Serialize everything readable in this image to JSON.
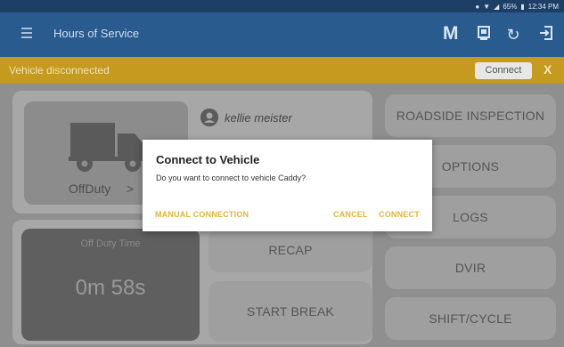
{
  "status_bar": {
    "battery": "65%",
    "time": "12:34 PM"
  },
  "app_bar": {
    "title": "Hours of Service",
    "m_label": "M",
    "icons": [
      "menu-icon",
      "clipboard-icon",
      "refresh-icon",
      "logout-icon"
    ]
  },
  "banner": {
    "text": "Vehicle disconnected",
    "connect_label": "Connect",
    "close_label": "X",
    "color": "#c49a1f"
  },
  "status_card": {
    "duty_status": "OffDuty",
    "chevron": ">"
  },
  "user": {
    "name": "kellie meister"
  },
  "timer": {
    "label": "Off Duty Time",
    "value": "0m 58s"
  },
  "buttons": {
    "recap": "RECAP",
    "start_break": "START BREAK",
    "roadside_inspection": "ROADSIDE INSPECTION",
    "options": "OPTIONS",
    "logs": "LOGS",
    "dvir": "DVIR",
    "shift_cycle": "SHIFT/CYCLE"
  },
  "dialog": {
    "title": "Connect to Vehicle",
    "message": "Do you want to connect to vehicle Caddy?",
    "manual_connection": "MANUAL CONNECTION",
    "cancel": "CANCEL",
    "connect": "CONNECT",
    "action_color": "#e0b43a"
  },
  "colors": {
    "status_bar": "#1d3f66",
    "app_bar": "#2a5b8e"
  }
}
